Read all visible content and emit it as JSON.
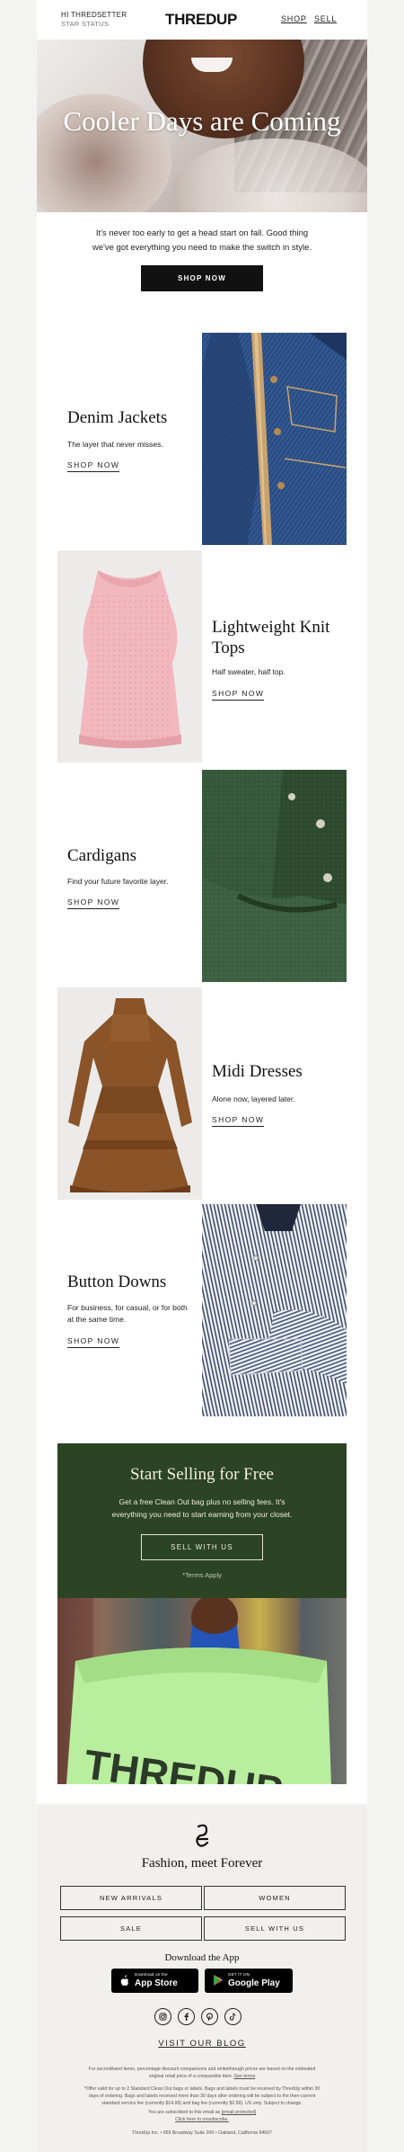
{
  "header": {
    "greeting": "HI THREDSETTER",
    "status": "STAR STATUS",
    "logo": "THREDUP",
    "nav": [
      "SHOP",
      "SELL"
    ]
  },
  "hero": {
    "title": "Cooler Days are Coming",
    "intro_line1": "It's never too early to get a head start on fall. Good thing",
    "intro_line2": "we've got everything you need to make the switch in style.",
    "cta": "SHOP NOW"
  },
  "sections": [
    {
      "title": "Denim Jackets",
      "desc": "The layer that never misses.",
      "cta": "SHOP NOW"
    },
    {
      "title": "Lightweight Knit Tops",
      "desc": "Half sweater, half top.",
      "cta": "SHOP NOW"
    },
    {
      "title": "Cardigans",
      "desc": "Find your future favorite layer.",
      "cta": "SHOP NOW"
    },
    {
      "title": "Midi Dresses",
      "desc": "Alone now, layered later.",
      "cta": "SHOP NOW"
    },
    {
      "title": "Button Downs",
      "desc": "For business, for casual, or for both at the same time.",
      "cta": "SHOP NOW"
    }
  ],
  "selling": {
    "title": "Start Selling for Free",
    "body": "Get a free Clean Out bag plus no selling fees. It's everything you need to start earning from your closet.",
    "cta": "SELL WITH US",
    "terms": "*Terms Apply",
    "bag_text": "THREDUP"
  },
  "footer": {
    "tagline": "Fashion, meet Forever",
    "links": [
      "NEW ARRIVALS",
      "WOMEN",
      "SALE",
      "SELL WITH US"
    ],
    "download": "Download the App",
    "app_store": {
      "small": "Download on the",
      "big": "App Store"
    },
    "google_play": {
      "small": "GET IT ON",
      "big": "Google Play"
    },
    "social_icons": [
      "instagram-icon",
      "facebook-icon",
      "pinterest-icon",
      "tiktok-icon"
    ],
    "blog": "VISIT OUR BLOG",
    "legal1": "For secondhand items, percentage discount comparisons and strikethrough prices are based on the estimated original retail price of a comparable item.",
    "legal1_link": "See terms",
    "legal2": "*Offer valid for up to 2 Standard Clean Out bags or labels. Bags and labels must be received by ThredUp within 30 days of ordering. Bags and labels received more than 30 days after ordering will be subject to the then-current standard service fee (currently $14.99) and bag fee (currently $2.99). US only. Subject to change.",
    "legal3": "You are subscribed to this email as",
    "legal3_email": "[email protected]",
    "unsubscribe": "Click here to unsubscribe.",
    "address": "ThredUp Inc. • 969 Broadway Suite 200 • Oakland, California 94607"
  }
}
